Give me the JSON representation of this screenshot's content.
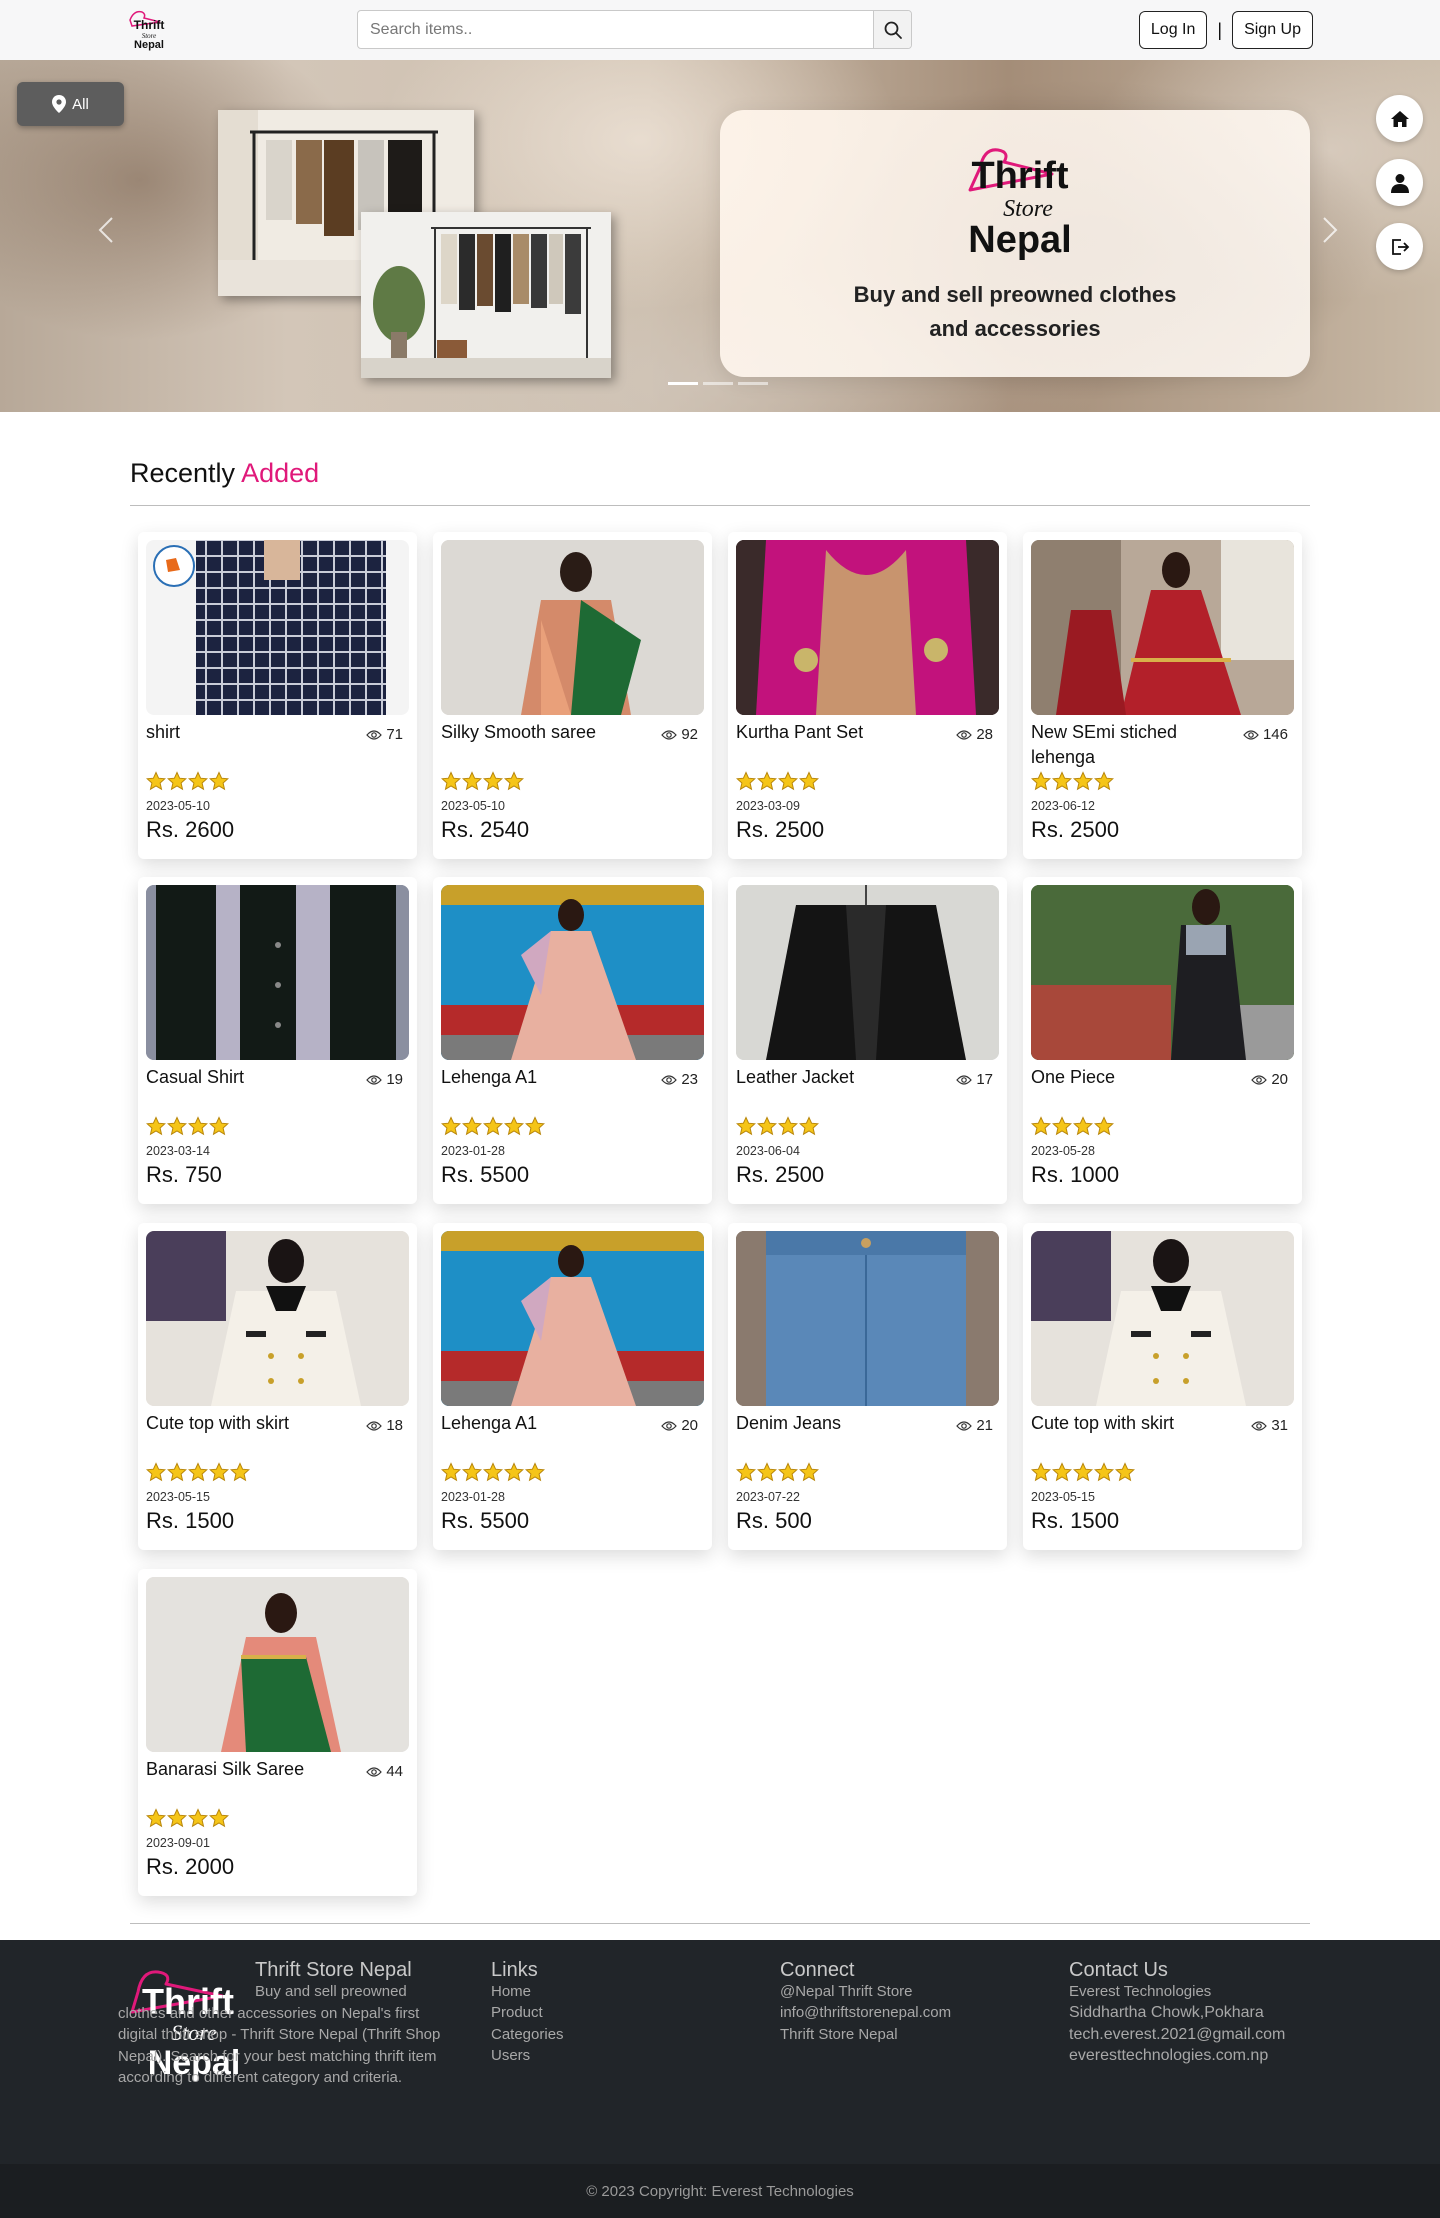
{
  "navbar": {
    "search_placeholder": "Search items..",
    "login_label": "Log In",
    "separator": "|",
    "signup_label": "Sign Up"
  },
  "hero": {
    "location_label": "All",
    "brand_line1": "Thrift",
    "brand_line2": "Store",
    "brand_line3": "Nepal",
    "tagline_line1": "Buy and sell preowned clothes",
    "tagline_line2": "and accessories",
    "slides": 3,
    "active_slide": 1
  },
  "section": {
    "title_plain": "Recently",
    "title_accent": "Added"
  },
  "products": [
    {
      "name": "shirt",
      "views": "71",
      "rating": 4,
      "date": "2023-05-10",
      "price": "Rs. 2600",
      "image": "plaid-shirt"
    },
    {
      "name": "Silky Smooth saree",
      "views": "92",
      "rating": 4,
      "date": "2023-05-10",
      "price": "Rs. 2540",
      "image": "saree"
    },
    {
      "name": "Kurtha Pant Set",
      "views": "28",
      "rating": 4,
      "date": "2023-03-09",
      "price": "Rs. 2500",
      "image": "kurtha"
    },
    {
      "name": "New SEmi stiched lehenga",
      "views": "146",
      "rating": 4,
      "date": "2023-06-12",
      "price": "Rs. 2500",
      "image": "red-lehenga"
    },
    {
      "name": "Casual Shirt",
      "views": "19",
      "rating": 4,
      "date": "2023-03-14",
      "price": "Rs. 750",
      "image": "casual-shirt"
    },
    {
      "name": "Lehenga A1",
      "views": "23",
      "rating": 5,
      "date": "2023-01-28",
      "price": "Rs. 5500",
      "image": "pink-lehenga"
    },
    {
      "name": "Leather Jacket",
      "views": "17",
      "rating": 4,
      "date": "2023-06-04",
      "price": "Rs. 2500",
      "image": "leather-jacket"
    },
    {
      "name": "One Piece",
      "views": "20",
      "rating": 4,
      "date": "2023-05-28",
      "price": "Rs. 1000",
      "image": "one-piece"
    },
    {
      "name": "Cute top with skirt",
      "views": "18",
      "rating": 5,
      "date": "2023-05-15",
      "price": "Rs. 1500",
      "image": "cute-top"
    },
    {
      "name": "Lehenga A1",
      "views": "20",
      "rating": 5,
      "date": "2023-01-28",
      "price": "Rs. 5500",
      "image": "pink-lehenga"
    },
    {
      "name": "Denim Jeans",
      "views": "21",
      "rating": 4,
      "date": "2023-07-22",
      "price": "Rs. 500",
      "image": "denim"
    },
    {
      "name": "Cute top with skirt",
      "views": "31",
      "rating": 5,
      "date": "2023-05-15",
      "price": "Rs. 1500",
      "image": "cute-top"
    },
    {
      "name": "Banarasi Silk Saree",
      "views": "44",
      "rating": 4,
      "date": "2023-09-01",
      "price": "Rs. 2000",
      "image": "green-saree"
    }
  ],
  "footer": {
    "brand_title": "Thrift Store Nepal",
    "about": "Buy and sell preowned clothes and other accessories on Nepal's first digital thrift shop - Thrift Store Nepal (Thrift Shop Nepal). Search for your best matching thrift item according to different category and criteria.",
    "links_title": "Links",
    "links": [
      "Home",
      "Product",
      "Categories",
      "Users"
    ],
    "connect_title": "Connect",
    "connect": [
      "@Nepal Thrift Store",
      "info@thriftstorenepal.com",
      "Thrift Store Nepal"
    ],
    "contact_title": "Contact Us",
    "contact": [
      "Everest Technologies",
      "Siddhartha Chowk,Pokhara",
      "tech.everest.2021@gmail.com",
      "everesttechnologies.com.np"
    ],
    "copyright": "© 2023 Copyright: Everest Technologies"
  },
  "colors": {
    "accent": "#e0197a",
    "footer_bg": "#212529",
    "star": "#f5c518"
  }
}
